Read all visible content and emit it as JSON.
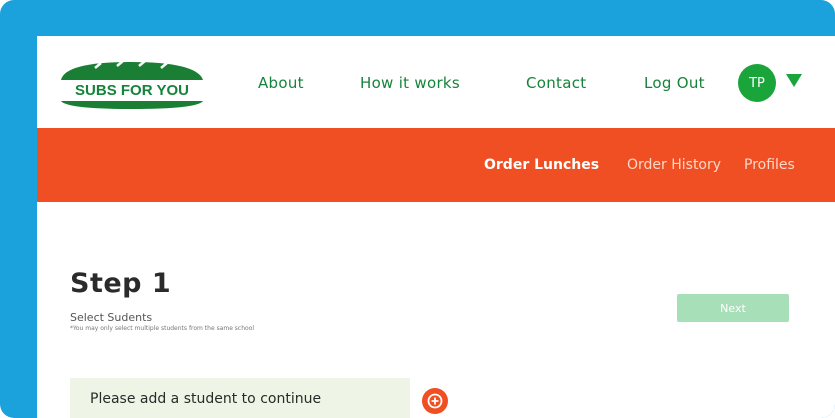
{
  "brand": {
    "name": "SUBS FOR YOU",
    "logo_color": "#16833a"
  },
  "nav": {
    "about": "About",
    "how_it_works": "How it works",
    "contact": "Contact",
    "logout": "Log Out"
  },
  "user": {
    "initials": "TP"
  },
  "subnav": {
    "order_lunches": "Order Lunches",
    "order_history": "Order History",
    "profiles": "Profiles"
  },
  "step": {
    "title": "Step 1",
    "subtitle": "Select Sudents",
    "note": "*You may only select multiple students from the same school",
    "next_label": "Next"
  },
  "student_prompt": "Please add a student to continue",
  "colors": {
    "frame": "#1ba2dc",
    "accent_orange": "#ef4f23",
    "brand_green": "#1aa53a",
    "next_disabled": "#a7dfb8"
  }
}
